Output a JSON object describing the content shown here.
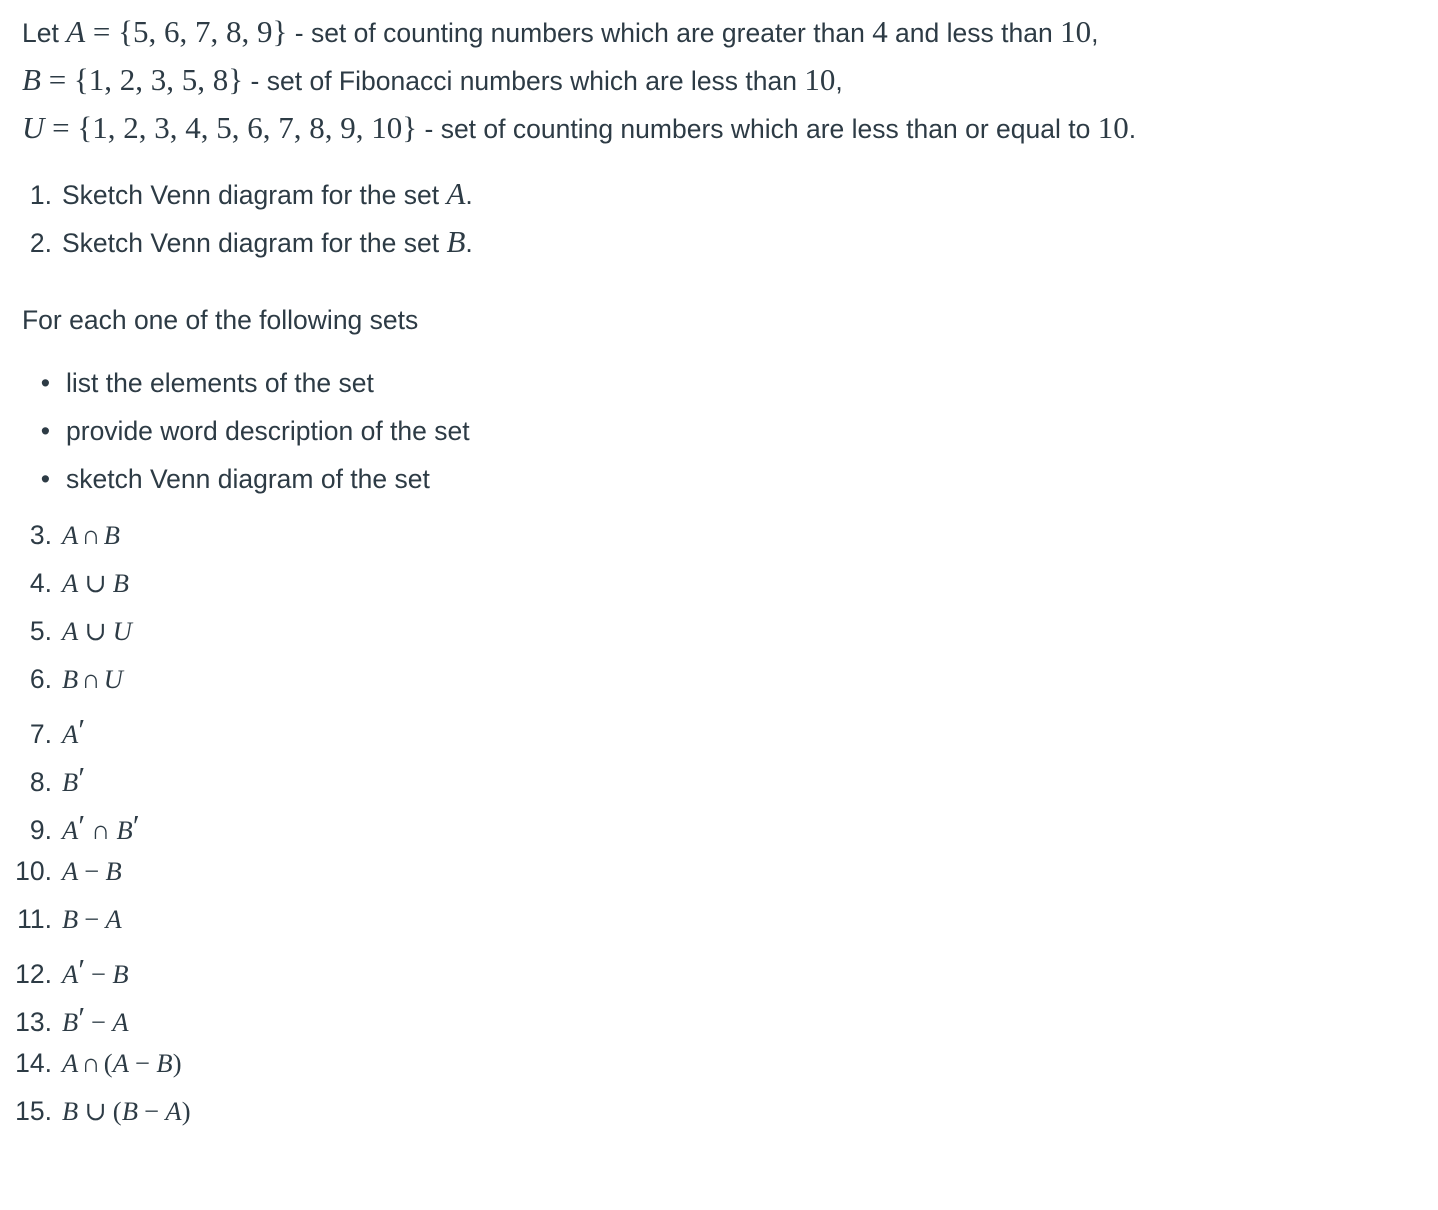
{
  "document": {
    "text_color": "#2d3b45",
    "background_color": "#ffffff"
  },
  "intro": {
    "line1": {
      "lead": "Let ",
      "var": "A",
      "equals": " = ",
      "set": "{5, 6, 7, 8, 9}",
      "desc_a": " - set of counting numbers which are greater than ",
      "num1": "4",
      "desc_b": " and less than ",
      "num2": "10",
      "tail": ","
    },
    "line2": {
      "var": "B",
      "equals": " = ",
      "set": "{1, 2, 3, 5, 8}",
      "desc_a": " - set of Fibonacci numbers which are less than ",
      "num1": "10",
      "tail": ","
    },
    "line3": {
      "var": "U",
      "equals": " = ",
      "set": "{1, 2, 3, 4, 5, 6, 7, 8, 9, 10}",
      "desc_a": " - set of counting numbers which are less than or equal to ",
      "num1": "10",
      "tail": "."
    }
  },
  "list_top": {
    "items": [
      {
        "marker": "1.",
        "text": "Sketch Venn diagram for the set ",
        "var": "A",
        "tail": "."
      },
      {
        "marker": "2.",
        "text": "Sketch Venn diagram for the set ",
        "var": "B",
        "tail": "."
      }
    ]
  },
  "para_each": {
    "text": "For each one of the following sets"
  },
  "bullets": {
    "marker": "•",
    "items": [
      {
        "text": "list the elements of the set"
      },
      {
        "text": "provide word description of the set"
      },
      {
        "text": "sketch Venn diagram of the set"
      }
    ]
  },
  "list_main": {
    "items": [
      {
        "marker": "3.",
        "expr": "A ∩ B",
        "parts": [
          {
            "t": "A",
            "k": "var"
          },
          {
            "t": "∩",
            "k": "opn"
          },
          {
            "t": "B",
            "k": "var"
          }
        ]
      },
      {
        "marker": "4.",
        "expr": "A ∪ B",
        "parts": [
          {
            "t": "A",
            "k": "var"
          },
          {
            "t": "∪",
            "k": "op"
          },
          {
            "t": "B",
            "k": "var"
          }
        ]
      },
      {
        "marker": "5.",
        "expr": "A ∪ U",
        "parts": [
          {
            "t": "A",
            "k": "var"
          },
          {
            "t": "∪",
            "k": "op"
          },
          {
            "t": "U",
            "k": "var"
          }
        ]
      },
      {
        "marker": "6.",
        "expr": "B ∩ U",
        "parts": [
          {
            "t": "B",
            "k": "var"
          },
          {
            "t": "∩",
            "k": "opn"
          },
          {
            "t": "U",
            "k": "var"
          }
        ]
      },
      {
        "marker": "7.",
        "expr": "A′",
        "parts": [
          {
            "t": "A",
            "k": "var"
          },
          {
            "t": "′",
            "k": "prime"
          }
        ]
      },
      {
        "marker": "8.",
        "expr": "B′",
        "parts": [
          {
            "t": "B",
            "k": "var"
          },
          {
            "t": "′",
            "k": "prime"
          }
        ]
      },
      {
        "marker": "9.",
        "expr": "A′ ∩ B′",
        "parts": [
          {
            "t": "A",
            "k": "var"
          },
          {
            "t": "′",
            "k": "prime"
          },
          {
            "t": "∩",
            "k": "op"
          },
          {
            "t": "B",
            "k": "var"
          },
          {
            "t": "′",
            "k": "prime"
          }
        ]
      },
      {
        "marker": "10.",
        "expr": "A − B",
        "parts": [
          {
            "t": "A",
            "k": "var"
          },
          {
            "t": "−",
            "k": "op"
          },
          {
            "t": "B",
            "k": "var"
          }
        ]
      },
      {
        "marker": "11.",
        "expr": "B − A",
        "parts": [
          {
            "t": "B",
            "k": "var"
          },
          {
            "t": "−",
            "k": "op"
          },
          {
            "t": "A",
            "k": "var"
          }
        ]
      },
      {
        "marker": "12.",
        "expr": "A′ − B",
        "parts": [
          {
            "t": "A",
            "k": "var"
          },
          {
            "t": "′",
            "k": "prime"
          },
          {
            "t": "−",
            "k": "op"
          },
          {
            "t": "B",
            "k": "var"
          }
        ]
      },
      {
        "marker": "13.",
        "expr": "B′ − A",
        "parts": [
          {
            "t": "B",
            "k": "var"
          },
          {
            "t": "′",
            "k": "prime"
          },
          {
            "t": "−",
            "k": "op"
          },
          {
            "t": "A",
            "k": "var"
          }
        ]
      },
      {
        "marker": "14.",
        "expr": "A ∩ (A − B)",
        "parts": [
          {
            "t": "A",
            "k": "var"
          },
          {
            "t": "∩",
            "k": "opn"
          },
          {
            "t": "(",
            "k": "up"
          },
          {
            "t": "A",
            "k": "var"
          },
          {
            "t": "−",
            "k": "op"
          },
          {
            "t": "B",
            "k": "var"
          },
          {
            "t": ")",
            "k": "up"
          }
        ]
      },
      {
        "marker": "15.",
        "expr": "B ∪ (B − A)",
        "parts": [
          {
            "t": "B",
            "k": "var"
          },
          {
            "t": "∪",
            "k": "op"
          },
          {
            "t": "(",
            "k": "up"
          },
          {
            "t": "B",
            "k": "var"
          },
          {
            "t": "−",
            "k": "op"
          },
          {
            "t": "A",
            "k": "var"
          },
          {
            "t": ")",
            "k": "up"
          }
        ]
      }
    ]
  }
}
